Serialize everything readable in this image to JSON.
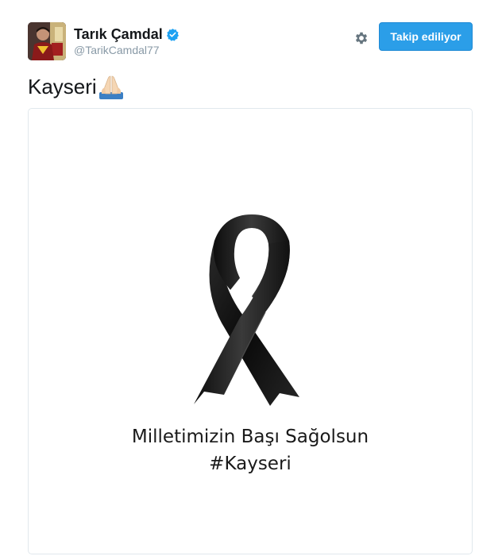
{
  "user": {
    "full_name": "Tarık Çamdal",
    "handle": "@TarikCamdal77",
    "verified": true
  },
  "actions": {
    "follow_label": "Takip ediliyor",
    "settings_icon": "gear-icon"
  },
  "tweet": {
    "text": "Kayseri",
    "emoji": "folded-hands-emoji"
  },
  "media": {
    "icon": "black-ribbon",
    "caption_line1": "Milletimizin Başı Sağolsun",
    "caption_line2": "#Kayseri"
  },
  "colors": {
    "accent": "#2b9ee8",
    "handle": "#8899a6",
    "text": "#14171a"
  }
}
